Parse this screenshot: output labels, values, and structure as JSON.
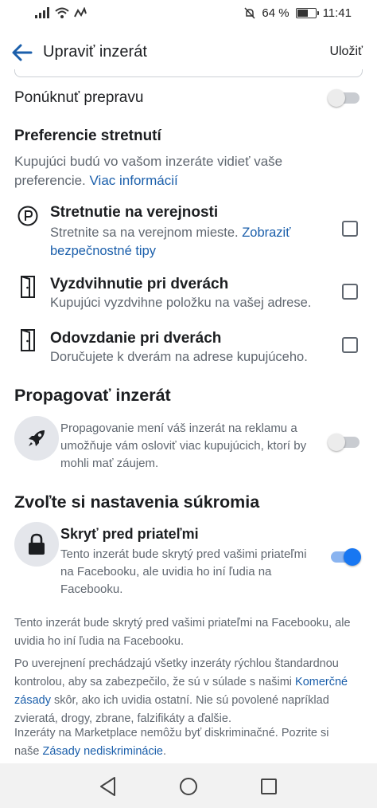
{
  "status_bar": {
    "battery_text": "64 %",
    "battery_level": 0.64,
    "time": "11:41"
  },
  "header": {
    "title": "Upraviť inzerát",
    "save_label": "Uložiť"
  },
  "shipping": {
    "label": "Ponúknuť prepravu",
    "enabled": false
  },
  "meeting": {
    "heading": "Preferencie stretnutí",
    "desc_line1": "Kupujúci budú vo vašom inzeráte vidieť vaše",
    "desc_line2": "preferencie.",
    "more_link": "Viac informácií",
    "options": [
      {
        "title": "Stretnutie na verejnosti",
        "sub1": "Stretnite sa na verejnom mieste.",
        "link1": "Zobraziť",
        "link2": "bezpečnostné tipy",
        "checked": false
      },
      {
        "title": "Vyzdvihnutie pri dverách",
        "sub1": "Kupujúci vyzdvihne položku na vašej adrese.",
        "checked": false
      },
      {
        "title": "Odovzdanie pri dverách",
        "sub1": "Doručujete k dverám na adrese kupujúceho.",
        "checked": false
      }
    ]
  },
  "promote": {
    "heading": "Propagovať inzerát",
    "line1": "Propagovanie mení váš inzerát na reklamu a",
    "line2": "umožňuje vám osloviť viac kupujúcich, ktorí by",
    "line3": "mohli mať záujem.",
    "enabled": false
  },
  "privacy": {
    "heading": "Zvoľte si nastavenia súkromia",
    "option_title": "Skryť pred priateľmi",
    "line1": "Tento inzerát bude skrytý pred vašimi priateľmi",
    "line2": "na Facebooku, ale uvidia ho iní ľudia na",
    "line3": "Facebooku.",
    "enabled": true
  },
  "footer": {
    "p1_line1": "Tento inzerát bude skrytý pred vašimi priateľmi na Facebooku, ale",
    "p1_line2": "uvidia ho iní ľudia na Facebooku.",
    "p2_line1": "Po uverejnení prechádzajú všetky inzeráty rýchlou štandardnou",
    "p2_line2_a": "kontrolou, aby sa zabezpečilo, že sú v súlade s našimi",
    "p2_link_a": "Komerčné",
    "p2_link_b": "zásady",
    "p2_line3_b": "skôr, ako ich uvidia ostatní. Nie sú povolené napríklad",
    "p2_line4": "zvieratá, drogy, zbrane, falzifikáty a ďalšie.",
    "p3_line1": "Inzeráty na Marketplace nemôžu byť diskriminačné. Pozrite si",
    "p3_line2_a": "naše",
    "p3_link": "Zásady nediskriminácie",
    "p3_line2_b": "."
  },
  "colors": {
    "accent": "#1877f2",
    "link": "#1b5fab",
    "text": "#1c1e21",
    "secondary_text": "#606770"
  },
  "icons": {
    "back": "arrow-left-icon",
    "parking": "parking-icon",
    "door": "door-icon",
    "rocket": "rocket-icon",
    "lock": "lock-icon"
  }
}
